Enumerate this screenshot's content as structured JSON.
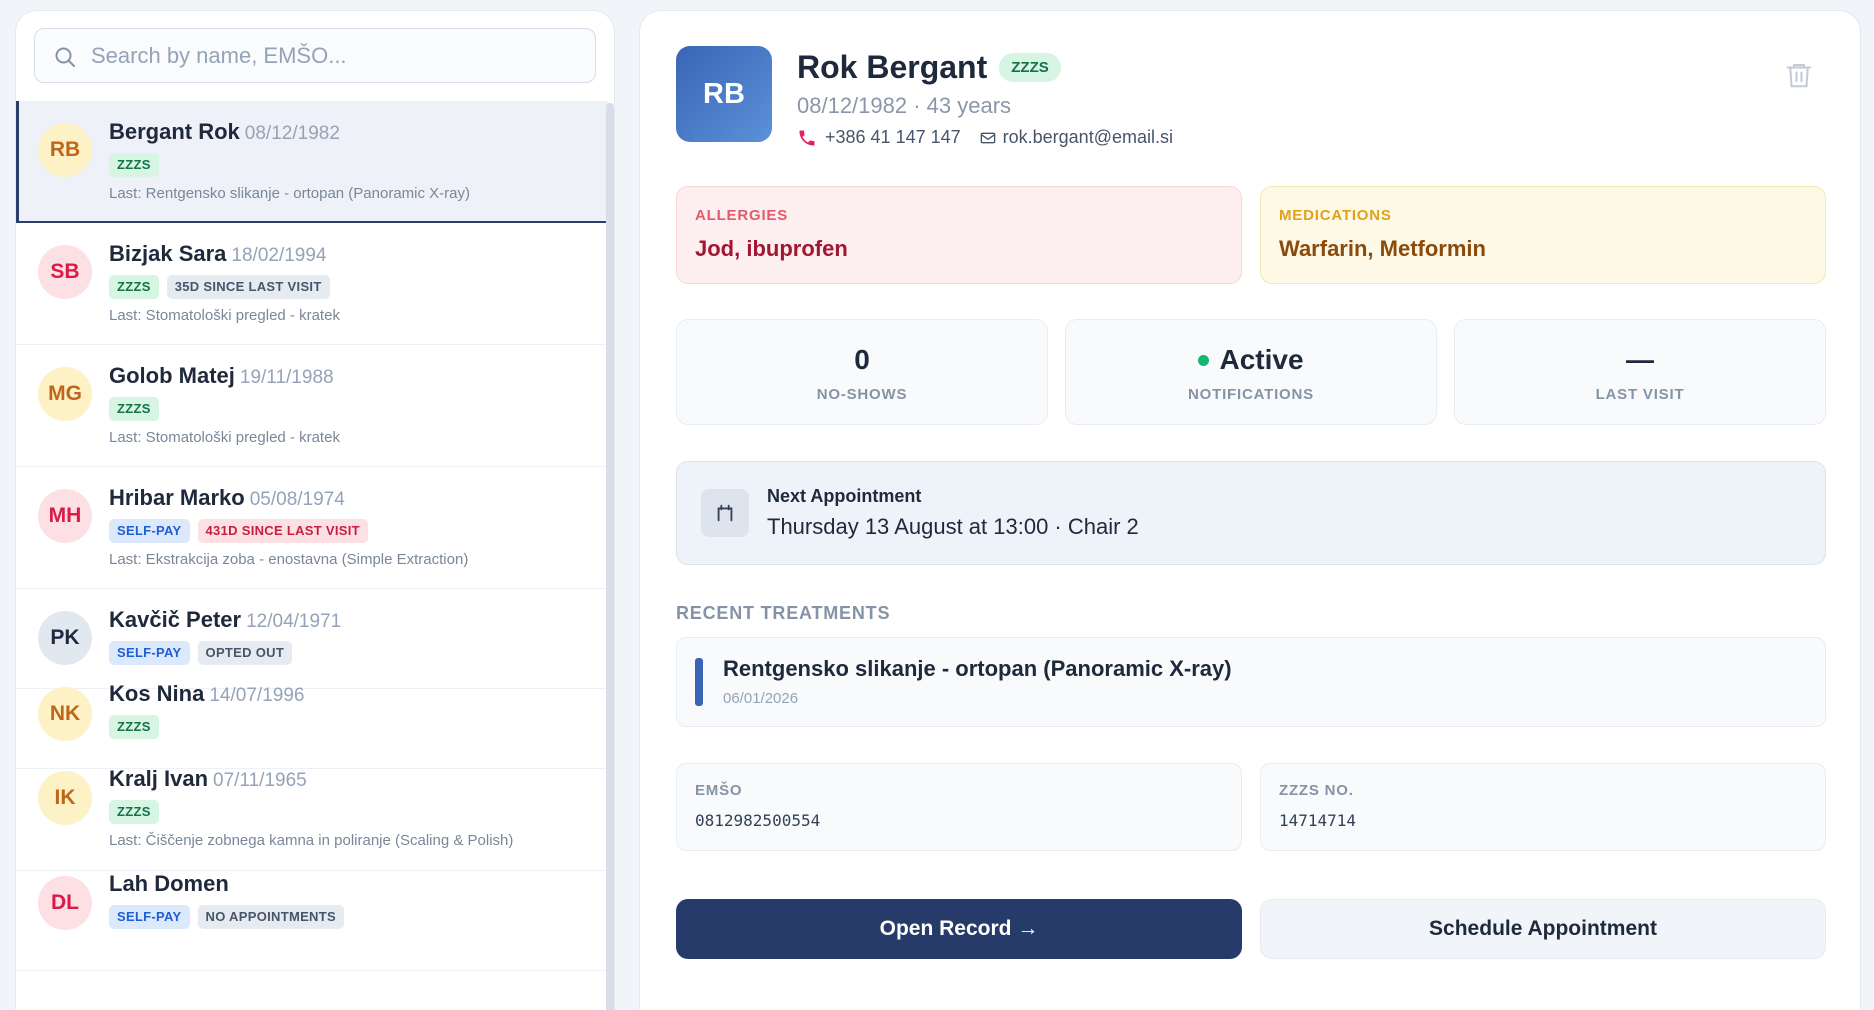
{
  "search": {
    "placeholder": "Search by name, EMŠO..."
  },
  "patients": [
    {
      "initials": "RB",
      "name": "Bergant Rok",
      "dob": "08/12/1982",
      "tags": [
        "ZZZS"
      ],
      "last": "Last: Rentgensko slikanje - ortopan (Panoramic X-ray)"
    },
    {
      "initials": "SB",
      "name": "Bizjak Sara",
      "dob": "18/02/1994",
      "tags": [
        "ZZZS",
        "35D SINCE LAST VISIT"
      ],
      "last": "Last: Stomatološki pregled - kratek"
    },
    {
      "initials": "MG",
      "name": "Golob Matej",
      "dob": "19/11/1988",
      "tags": [
        "ZZZS"
      ],
      "last": "Last: Stomatološki pregled - kratek"
    },
    {
      "initials": "MH",
      "name": "Hribar Marko",
      "dob": "05/08/1974",
      "tags": [
        "SELF-PAY",
        "431D SINCE LAST VISIT"
      ],
      "last": "Last: Ekstrakcija zoba - enostavna (Simple Extraction)"
    },
    {
      "initials": "PK",
      "name": "Kavčič Peter",
      "dob": "12/04/1971",
      "tags": [
        "SELF-PAY",
        "OPTED OUT"
      ],
      "last": ""
    },
    {
      "initials": "NK",
      "name": "Kos Nina",
      "dob": "14/07/1996",
      "tags": [
        "ZZZS"
      ],
      "last": ""
    },
    {
      "initials": "IK",
      "name": "Kralj Ivan",
      "dob": "07/11/1965",
      "tags": [
        "ZZZS"
      ],
      "last": "Last: Čiščenje zobnega kamna in poliranje (Scaling & Polish)"
    },
    {
      "initials": "DL",
      "name": "Lah Domen",
      "dob": "",
      "tags": [
        "SELF-PAY",
        "NO APPOINTMENTS"
      ],
      "last": ""
    }
  ],
  "detail": {
    "initials": "RB",
    "name": "Rok Bergant",
    "insurance_tag": "ZZZS",
    "sub": "08/12/1982 · 43 years",
    "phone": "+386 41 147 147",
    "email": "rok.bergant@email.si",
    "allergies": {
      "label": "ALLERGIES",
      "value": "Jod, ibuprofen"
    },
    "medications": {
      "label": "MEDICATIONS",
      "value": "Warfarin, Metformin"
    },
    "stats": [
      {
        "value": "0",
        "label": "NO-SHOWS"
      },
      {
        "value": "Active",
        "label": "NOTIFICATIONS"
      },
      {
        "value": "—",
        "label": "LAST VISIT"
      }
    ],
    "next_appointment": {
      "label": "Next Appointment",
      "value": "Thursday 13 August at 13:00 · Chair 2"
    },
    "recent_title": "RECENT TREATMENTS",
    "treatments": [
      {
        "name": "Rentgensko slikanje - ortopan (Panoramic X-ray)",
        "date": "06/01/2026"
      }
    ],
    "emso": {
      "label": "EMŠO",
      "value": "0812982500554"
    },
    "zzzs": {
      "label": "ZZZS NO.",
      "value": "14714714"
    },
    "open_record": "Open Record →",
    "schedule": "Schedule Appointment"
  },
  "colors": {
    "primary": "#263b6a",
    "accent": "#3a64b6",
    "active_dot": "#16b66e",
    "allergy_text": "#a11632",
    "medication_text": "#8a4a0b"
  },
  "icons": [
    "search-icon",
    "phone-icon",
    "mail-icon",
    "trash-icon",
    "calendar-icon"
  ]
}
